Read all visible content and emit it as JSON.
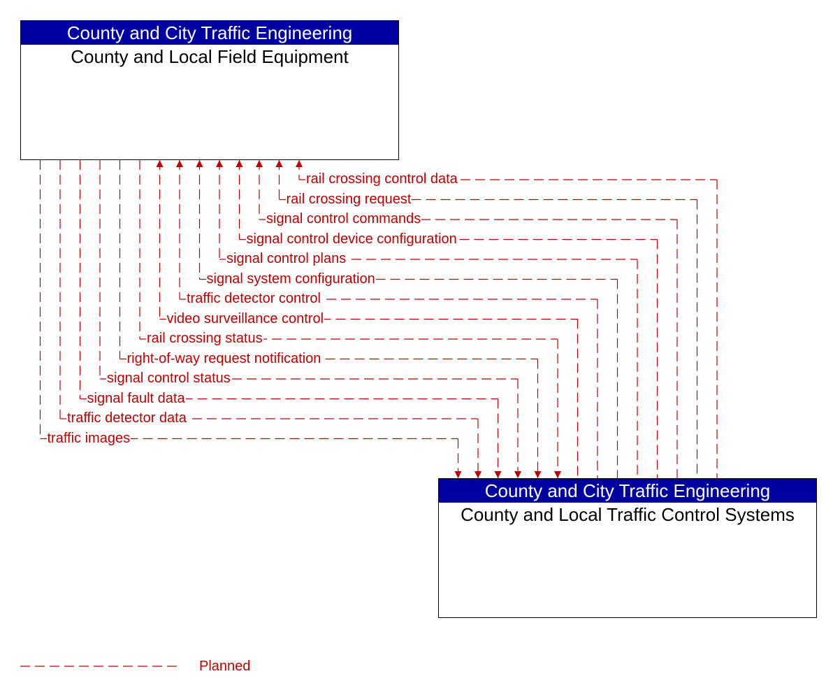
{
  "nodes": {
    "top": {
      "owner": "County and City Traffic Engineering",
      "name": "County and Local Field Equipment"
    },
    "bottom": {
      "owner": "County and City Traffic Engineering",
      "name": "County and Local Traffic Control Systems"
    }
  },
  "colors": {
    "header_bg": "#0000a0",
    "flow": "#c00000"
  },
  "flows": [
    {
      "label": "rail crossing control data",
      "direction": "to-top"
    },
    {
      "label": "rail crossing request",
      "direction": "to-top"
    },
    {
      "label": "signal control commands",
      "direction": "to-top"
    },
    {
      "label": "signal control device configuration",
      "direction": "to-top"
    },
    {
      "label": "signal control plans",
      "direction": "to-top"
    },
    {
      "label": "signal system configuration",
      "direction": "to-top"
    },
    {
      "label": "traffic detector control",
      "direction": "to-top"
    },
    {
      "label": "video surveillance control",
      "direction": "to-top"
    },
    {
      "label": "rail crossing status",
      "direction": "to-bottom"
    },
    {
      "label": "right-of-way request notification",
      "direction": "to-bottom"
    },
    {
      "label": "signal control status",
      "direction": "to-bottom"
    },
    {
      "label": "signal fault data",
      "direction": "to-bottom"
    },
    {
      "label": "traffic detector data",
      "direction": "to-bottom"
    },
    {
      "label": "traffic images",
      "direction": "to-bottom"
    }
  ],
  "legend": {
    "label": "Planned",
    "line_style": "dashed"
  }
}
